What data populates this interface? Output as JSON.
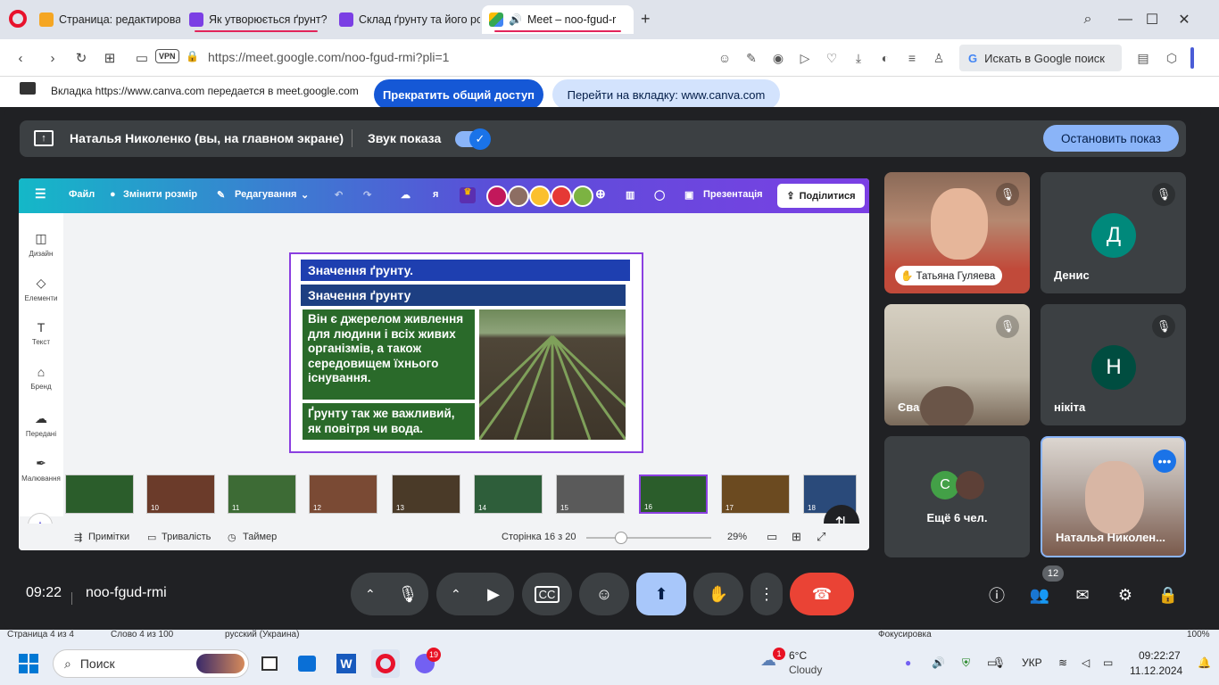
{
  "browser": {
    "tabs": [
      {
        "title": "Страница: редактирован",
        "color": "#f5b400"
      },
      {
        "title": "Як утворюється ґрунт? –",
        "color": "#7b3fe4"
      },
      {
        "title": "Склад ґрунту та його род",
        "color": "#7b3fe4"
      },
      {
        "title": "Meet – noo-fgud-r",
        "color": "#00897b"
      }
    ],
    "url": "https://meet.google.com/noo-fgud-rmi?pli=1",
    "vpn": "VPN",
    "google_search": "Искать в Google поиск"
  },
  "sharebar": {
    "message": "Вкладка https://www.canva.com передается в meet.google.com",
    "stop_label": "Прекратить общий доступ",
    "goto_label": "Перейти на вкладку: www.canva.com"
  },
  "presenting": {
    "name": "Наталья Николенко (вы, на главном экране)",
    "sound_label": "Звук показа",
    "stop_label": "Остановить показ"
  },
  "canva": {
    "menu": [
      "Файл",
      "Змінити розмір",
      "Редагування"
    ],
    "user_initial": "я",
    "presentation_label": "Презентація",
    "share_label": "Поділитися",
    "sidebar": [
      "Дизайн",
      "Елементи",
      "Текст",
      "Бренд",
      "Передані",
      "Малювання"
    ],
    "slide": {
      "title1": "Значення ґрунту.",
      "title2": "Значення ґрунту",
      "text1": "Він є джерелом живлення для людини і всіх живих організмів, а також середовищем їхнього існування.",
      "text2": "Ґрунту так же важливий, як повітря чи вода."
    },
    "thumbs": [
      "",
      "10",
      "11",
      "12",
      "13",
      "14",
      "15",
      "16",
      "17",
      "18"
    ],
    "bottom": {
      "notes": "Примітки",
      "duration": "Тривалість",
      "timer": "Таймер",
      "page": "Сторінка 16 з 20",
      "zoom": "29%"
    }
  },
  "participants": [
    {
      "name": "Татьяна Гуляева",
      "muted": true
    },
    {
      "name": "Денис",
      "initial": "Д",
      "color": "#00897b",
      "muted": true
    },
    {
      "name": "Єва",
      "muted": true
    },
    {
      "name": "нікіта",
      "initial": "Н",
      "color": "#004d40",
      "muted": true
    },
    {
      "name": "Ещё 6 чел.",
      "initial": "C",
      "color": "#43a047"
    },
    {
      "name": "Наталья Николен..."
    }
  ],
  "meeting": {
    "time": "09:22",
    "code": "noo-fgud-rmi",
    "people_count": "12"
  },
  "statusbar": {
    "left": "Страница 4 из 4",
    "words": "Слово 4 из 100",
    "lang": "русский (Украина)",
    "focus": "Фокусировка",
    "zoom": "100%"
  },
  "taskbar": {
    "search": "Поиск",
    "viber_badge": "19",
    "weather_badge": "1",
    "temp": "6°C",
    "weather": "Cloudy",
    "lang": "УКР",
    "time": "09:22:27",
    "date": "11.12.2024"
  }
}
